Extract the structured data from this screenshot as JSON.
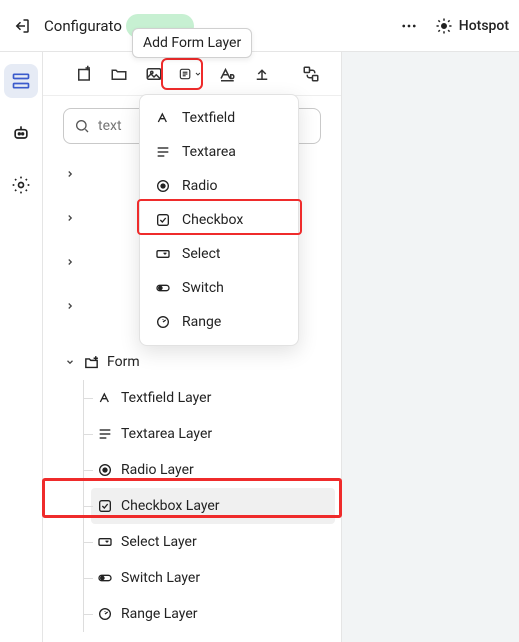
{
  "topbar": {
    "title": "Configurato",
    "hotspot_label": "Hotspot"
  },
  "tooltip": "Add Form Layer",
  "search": {
    "placeholder": "text"
  },
  "dropdown": {
    "items": [
      {
        "label": "Textfield"
      },
      {
        "label": "Textarea"
      },
      {
        "label": "Radio"
      },
      {
        "label": "Checkbox"
      },
      {
        "label": "Select"
      },
      {
        "label": "Switch"
      },
      {
        "label": "Range"
      }
    ]
  },
  "tree": {
    "form_label": "Form",
    "children": [
      {
        "label": "Textfield Layer"
      },
      {
        "label": "Textarea Layer"
      },
      {
        "label": "Radio Layer"
      },
      {
        "label": "Checkbox Layer"
      },
      {
        "label": "Select Layer"
      },
      {
        "label": "Switch Layer"
      },
      {
        "label": "Range Layer"
      }
    ]
  }
}
